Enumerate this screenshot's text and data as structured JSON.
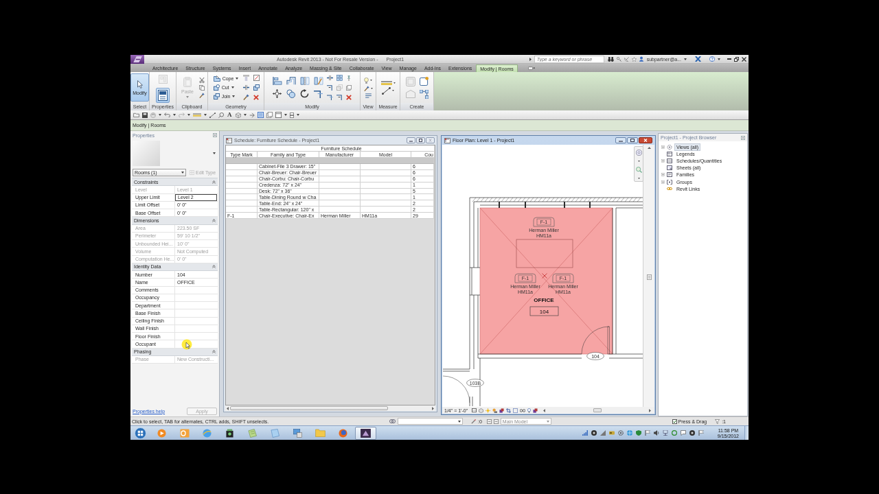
{
  "window": {
    "title": "Autodesk Revit 2013 - Not For Resale Version -",
    "document": "Project1"
  },
  "search": {
    "placeholder": "Type a keyword or phrase"
  },
  "account": {
    "user": "subpartner@a..."
  },
  "ribbon_tabs": [
    {
      "label": "Architecture",
      "selected": false
    },
    {
      "label": "Structure",
      "selected": false
    },
    {
      "label": "Systems",
      "selected": false
    },
    {
      "label": "Insert",
      "selected": false
    },
    {
      "label": "Annotate",
      "selected": false
    },
    {
      "label": "Analyze",
      "selected": false
    },
    {
      "label": "Massing & Site",
      "selected": false
    },
    {
      "label": "Collaborate",
      "selected": false
    },
    {
      "label": "View",
      "selected": false
    },
    {
      "label": "Manage",
      "selected": false
    },
    {
      "label": "Add-Ins",
      "selected": false
    },
    {
      "label": "Extensions",
      "selected": false
    },
    {
      "label": "Modify | Rooms",
      "selected": true
    }
  ],
  "ribbon_panels": [
    {
      "label": "Select",
      "kind": "select",
      "tools": [
        {
          "kind": "large",
          "label": "Modify",
          "selected": true,
          "disabled": false
        }
      ]
    },
    {
      "label": "Properties",
      "kind": "properties",
      "tools": [
        {
          "kind": "icon",
          "selected": false,
          "disabled": true
        },
        {
          "kind": "icon",
          "selected": true,
          "disabled": false
        }
      ]
    },
    {
      "label": "Clipboard",
      "kind": "clipboard",
      "tools": [
        {
          "kind": "large",
          "label": "Paste",
          "selected": false,
          "disabled": true
        }
      ]
    },
    {
      "label": "Geometry",
      "kind": "geometry",
      "tools": [
        {
          "kind": "small",
          "label": "Cope",
          "selected": false,
          "disabled": false
        },
        {
          "kind": "small",
          "label": "Cut",
          "selected": false,
          "disabled": false
        },
        {
          "kind": "small",
          "label": "Join",
          "selected": false,
          "disabled": false
        }
      ]
    },
    {
      "label": "Modify",
      "kind": "modify"
    },
    {
      "label": "View",
      "kind": "view"
    },
    {
      "label": "Measure",
      "kind": "measure"
    },
    {
      "label": "Create",
      "kind": "create"
    }
  ],
  "quick_access_toolbar": {
    "text_tool": "A"
  },
  "options_bar": {
    "context": "Modify | Rooms"
  },
  "properties": {
    "title": "Properties",
    "type_selector": "Rooms (1)",
    "edit_type": {
      "label": "Edit Type",
      "disabled": true
    },
    "groups": [
      {
        "name": "Constraints",
        "expanded": true,
        "rows": [
          {
            "label": "Level",
            "value": "Level 1",
            "disabled": true,
            "selected": false
          },
          {
            "label": "Upper Limit",
            "value": "Level 2",
            "disabled": false,
            "selected": true
          },
          {
            "label": "Limit Offset",
            "value": "0' 0\"",
            "disabled": false,
            "selected": false
          },
          {
            "label": "Base Offset",
            "value": "0' 0\"",
            "disabled": false,
            "selected": false
          }
        ]
      },
      {
        "name": "Dimensions",
        "expanded": true,
        "rows": [
          {
            "label": "Area",
            "value": "223.50 SF",
            "disabled": true,
            "selected": false
          },
          {
            "label": "Perimeter",
            "value": "59' 10 1/2\"",
            "disabled": true,
            "selected": false
          },
          {
            "label": "Unbounded Hei...",
            "value": "10' 0\"",
            "disabled": true,
            "selected": false
          },
          {
            "label": "Volume",
            "value": "Not Computed",
            "disabled": true,
            "selected": false
          },
          {
            "label": "Computation He...",
            "value": "0' 0\"",
            "disabled": true,
            "selected": false
          }
        ]
      },
      {
        "name": "Identity Data",
        "expanded": true,
        "rows": [
          {
            "label": "Number",
            "value": "104",
            "disabled": false,
            "selected": false
          },
          {
            "label": "Name",
            "value": "OFFICE",
            "disabled": false,
            "selected": false
          },
          {
            "label": "Comments",
            "disabled": false,
            "selected": false
          },
          {
            "label": "Occupancy",
            "disabled": false,
            "selected": false
          },
          {
            "label": "Department",
            "disabled": false,
            "selected": false
          },
          {
            "label": "Base Finish",
            "disabled": false,
            "selected": false
          },
          {
            "label": "Ceiling Finish",
            "disabled": false,
            "selected": false
          },
          {
            "label": "Wall Finish",
            "disabled": false,
            "selected": false
          },
          {
            "label": "Floor Finish",
            "disabled": false,
            "selected": false
          },
          {
            "label": "Occupant",
            "disabled": false,
            "selected": false
          }
        ]
      },
      {
        "name": "Phasing",
        "expanded": true,
        "rows": [
          {
            "label": "Phase",
            "value": "New Constructi...",
            "disabled": true,
            "selected": false
          }
        ]
      }
    ],
    "help_link": "Properties help",
    "apply": {
      "label": "Apply",
      "disabled": true
    }
  },
  "schedule": {
    "title": "Schedule: Furniture Schedule - Project1",
    "heading": "Furniture Schedule",
    "columns": [
      "Type Mark",
      "Family and Type",
      "Manufacturer",
      "Model",
      "Cou"
    ],
    "rows": [
      {
        "family_and_type": "Cabinet-File 3 Drawer: 15\"",
        "column_5": "6"
      },
      {
        "family_and_type": "Chair-Breuer: Chair-Breuer",
        "column_5": "6"
      },
      {
        "family_and_type": "Chair-Corbu: Chair-Corbu",
        "column_5": "6"
      },
      {
        "family_and_type": "Credenza: 72\" x 24\"",
        "column_5": "1"
      },
      {
        "family_and_type": "Desk: 72\" x 36\"",
        "column_5": "5"
      },
      {
        "family_and_type": "Table-Dining Round w Cha",
        "column_5": "1"
      },
      {
        "family_and_type": "Table-End: 24\" x 24\"",
        "column_5": "2"
      },
      {
        "family_and_type": "Table-Rectangular: 120\" x",
        "column_5": "2"
      },
      {
        "type_mark": "F-1",
        "family_and_type": "Chair-Executive: Chair-Ex",
        "manufacturer": "Herman Miller",
        "model": "HM11a",
        "column_5": "29"
      }
    ]
  },
  "floor_plan": {
    "title": "Floor Plan: Level 1 - Project1",
    "room": {
      "name": "OFFICE",
      "number": "104",
      "selected": true
    },
    "furniture": [
      {
        "mark": "F-1",
        "manufacturer": "Herman Miller",
        "model": "HM11a"
      },
      {
        "mark": "F-1",
        "manufacturer": "Herman Miller",
        "model": "HM11a"
      },
      {
        "mark": "F-1",
        "manufacturer": "Herman Miller",
        "model": "HM11a"
      }
    ],
    "door_tags": [
      "104",
      "103B"
    ],
    "scale": "1/4\" = 1'-0\""
  },
  "project_browser": {
    "title": "Project1 - Project Browser",
    "items": [
      {
        "label": "Views (all)",
        "kind": "views",
        "expandable": true,
        "selected": true
      },
      {
        "label": "Legends",
        "kind": "legends",
        "expandable": false,
        "selected": false
      },
      {
        "label": "Schedules/Quantities",
        "kind": "schedules",
        "expandable": true,
        "selected": false
      },
      {
        "label": "Sheets (all)",
        "kind": "sheets",
        "expandable": false,
        "selected": false
      },
      {
        "label": "Families",
        "kind": "families",
        "expandable": true,
        "selected": false
      },
      {
        "label": "Groups",
        "kind": "groups",
        "expandable": true,
        "selected": false
      },
      {
        "label": "Revit Links",
        "kind": "links",
        "expandable": false,
        "selected": false
      }
    ]
  },
  "status_bar": {
    "message": "Click to select, TAB for alternates, CTRL adds, SHIFT unselects.",
    "editable_count": ":0",
    "model": {
      "value": "Main Model",
      "disabled": true
    },
    "press_and_drag": {
      "label": "Press & Drag",
      "checked": true
    },
    "filter_count": ":1"
  },
  "taskbar": {
    "apps": [
      {
        "kind": "player",
        "selected": false
      },
      {
        "kind": "mail",
        "selected": false
      },
      {
        "kind": "globe",
        "selected": false
      },
      {
        "kind": "camera",
        "selected": false
      },
      {
        "kind": "notepad",
        "selected": false
      },
      {
        "kind": "sheet",
        "selected": false
      },
      {
        "kind": "screen",
        "selected": false
      },
      {
        "kind": "folder",
        "selected": false
      },
      {
        "kind": "orb",
        "selected": false
      },
      {
        "kind": "cad",
        "selected": true
      }
    ],
    "time": "11:58 PM",
    "date": "9/15/2012"
  }
}
